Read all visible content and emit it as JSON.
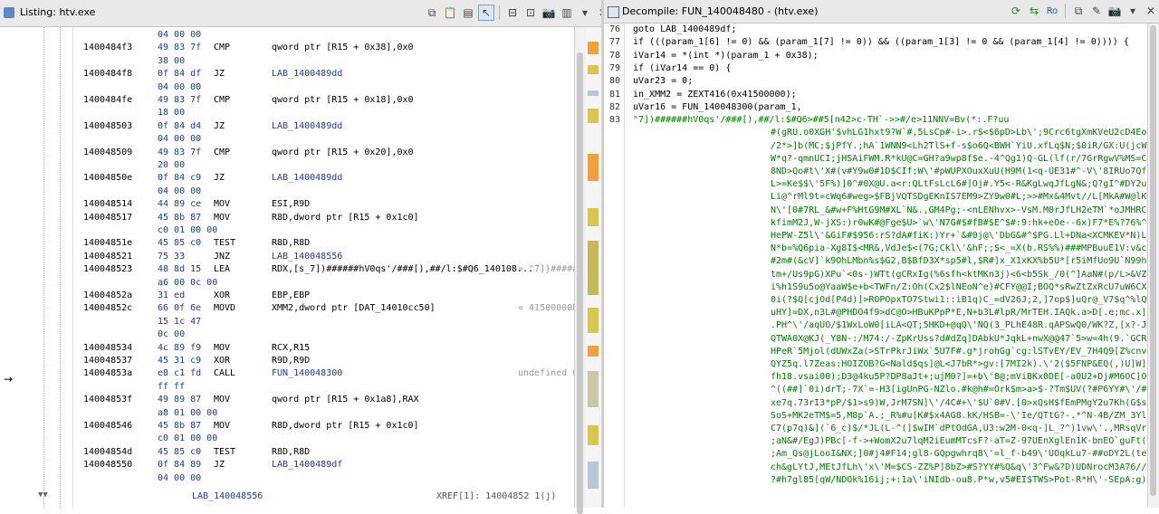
{
  "listing": {
    "title": "Listing:  htv.exe",
    "rows": [
      {
        "addr": "",
        "bytes": "04 00 00",
        "mn": "",
        "op": ""
      },
      {
        "addr": "1400484f3",
        "bytes": "49 83 7f",
        "mn": "CMP",
        "op": "qword ptr [R15 + 0x38],0x0"
      },
      {
        "addr": "",
        "bytes": "38 00",
        "mn": "",
        "op": ""
      },
      {
        "addr": "1400484f8",
        "bytes": "0f 84 df",
        "mn": "JZ",
        "op": "LAB_1400489dd"
      },
      {
        "addr": "",
        "bytes": "04 00 00",
        "mn": "",
        "op": ""
      },
      {
        "addr": "1400484fe",
        "bytes": "49 83 7f",
        "mn": "CMP",
        "op": "qword ptr [R15 + 0x18],0x0"
      },
      {
        "addr": "",
        "bytes": "18 00",
        "mn": "",
        "op": ""
      },
      {
        "addr": "140048503",
        "bytes": "0f 84 d4",
        "mn": "JZ",
        "op": "LAB_1400489dd"
      },
      {
        "addr": "",
        "bytes": "04 00 00",
        "mn": "",
        "op": ""
      },
      {
        "addr": "140048509",
        "bytes": "49 83 7f",
        "mn": "CMP",
        "op": "qword ptr [R15 + 0x20],0x0"
      },
      {
        "addr": "",
        "bytes": "20 00",
        "mn": "",
        "op": ""
      },
      {
        "addr": "14004850e",
        "bytes": "0f 84 c9",
        "mn": "JZ",
        "op": "LAB_1400489dd"
      },
      {
        "addr": "",
        "bytes": "04 00 00",
        "mn": "",
        "op": ""
      },
      {
        "addr": "140048514",
        "bytes": "44 89 ce",
        "mn": "MOV",
        "op": "ESI,R9D"
      },
      {
        "addr": "140048517",
        "bytes": "45 8b 87",
        "mn": "MOV",
        "op": "R8D,dword ptr [R15 + 0x1c0]"
      },
      {
        "addr": "",
        "bytes": "c0 01 00 00",
        "mn": "",
        "op": ""
      },
      {
        "addr": "14004851e",
        "bytes": "45 85 c0",
        "mn": "TEST",
        "op": "R8D,R8D"
      },
      {
        "addr": "140048521",
        "bytes": "75 33",
        "mn": "JNZ",
        "op": "LAB_140048556"
      },
      {
        "addr": "140048523",
        "bytes": "48 8d 15",
        "mn": "LEA",
        "op": "RDX,[s_7])######hV0qs'/###[),##/l:$#Q6_140108...",
        "cm": "= \"7]}#####"
      },
      {
        "addr": "",
        "bytes": "a6 00 0c 00",
        "mn": "",
        "op": ""
      },
      {
        "addr": "14004852a",
        "bytes": "31 ed",
        "mn": "XOR",
        "op": "EBP,EBP"
      },
      {
        "addr": "14004852c",
        "bytes": "66 0f 6e",
        "mn": "MOVD",
        "op": "XMM2,dword ptr [DAT_14010cc50]",
        "cm": "= 41500000h"
      },
      {
        "addr": "",
        "bytes": "15 1c 47",
        "mn": "",
        "op": ""
      },
      {
        "addr": "",
        "bytes": "0c 00",
        "mn": "",
        "op": ""
      },
      {
        "addr": "140048534",
        "bytes": "4c 89 f9",
        "mn": "MOV",
        "op": "RCX,R15"
      },
      {
        "addr": "140048537",
        "bytes": "45 31 c9",
        "mn": "XOR",
        "op": "R9D,R9D"
      },
      {
        "addr": "14004853a",
        "bytes": "e8 c1 fd",
        "mn": "CALL",
        "op": "FUN_140048300",
        "cm": "undefined F"
      },
      {
        "addr": "",
        "bytes": "ff ff",
        "mn": "",
        "op": ""
      },
      {
        "addr": "14004853f",
        "bytes": "49 89 87",
        "mn": "MOV",
        "op": "qword ptr [R15 + 0x1a8],RAX"
      },
      {
        "addr": "",
        "bytes": "a8 01 00 00",
        "mn": "",
        "op": ""
      },
      {
        "addr": "140048546",
        "bytes": "45 8b 87",
        "mn": "MOV",
        "op": "R8D,dword ptr [R15 + 0x1c0]"
      },
      {
        "addr": "",
        "bytes": "c0 01 00 00",
        "mn": "",
        "op": ""
      },
      {
        "addr": "14004854d",
        "bytes": "45 85 c0",
        "mn": "TEST",
        "op": "R8D,R8D"
      },
      {
        "addr": "140048550",
        "bytes": "0f 84 89",
        "mn": "JZ",
        "op": "LAB_1400489df"
      },
      {
        "addr": "",
        "bytes": "04 00 00",
        "mn": "",
        "op": ""
      }
    ],
    "footer_label": "LAB_140048556",
    "footer_xref": "XREF[1]:      14004852 1(j)"
  },
  "decompile": {
    "title": "Decompile: FUN_140048480 - (htv.exe)",
    "lines": [
      {
        "n": "76",
        "t": "  goto LAB_1400489df;"
      },
      {
        "n": "77",
        "t": "  if (((param_1[6] != 0) && (param_1[7] != 0)) && ((param_1[3] != 0 && (param_1[4] != 0)))) {"
      },
      {
        "n": "78",
        "t": "    iVar14 = *(int *)(param_1 + 0x38);"
      },
      {
        "n": "79",
        "t": "    if (iVar14 == 0) {"
      },
      {
        "n": "80",
        "t": "      uVar23 = 0;"
      },
      {
        "n": "81",
        "t": "      in_XMM2 = ZEXT416(0x41500000);"
      },
      {
        "n": "82",
        "t": "      uVar16 = FUN_140048300(param_1,"
      },
      {
        "n": "83",
        "t": "                   \"7])######hV0qs'/###[),##/l:$#Q6>##5[n42>c-TH`->>#/e>11NNV=Bv(*:.F?uu"
      }
    ],
    "string_lines": [
      "#(gRU.o0XGH'$vhLG1hxt9?W`#,5LsCp#-i>.r$<$6pD>Lb\\';9Crc6tgXmKVeU2cD4Eo3R",
      "/2*>]b(MC;$jPfY.;hA`1WNN9<Lh2TlS+f-s$o6Q<BWH`YiU.xfLq$N;$0iR/GX:U(jcW2p/",
      "W*q?-qmnUCI;jHSAiFWM.R*kU@C=GH?a9wp8f$e.-4^Qg1)Q-GL(lf(r/7GrRgwV%MS=C#`",
      "8ND>Qo#t\\'X#(v#Y9w0#1D$CIf;W\\'#pWUPXOuxXuU(H9M(1<q-UE31#^-V\\'8IRUo7Qf./",
      "L>=Ke$$\\'5F%)]0^#0X@U.a<r:QLtFsLcL6#]Oj#.Y5<-R&KgLwqJfLgN&;Q?gI^#DY2u",
      "Li@^rMl9t=cWq6#weg>$FBjVQTSDgEKnIS7EM9>ZY9w0#L;>>#Mx&4Mvt//L[MkA#W@lK.",
      "N\\'[0#7RL_&#w+F%HtG9M#XL`N&.,GM4Pg;-<nLENhvx>-VsM.M0rJfLH2eTM`*oJMHRC`N",
      "kfimM2J,W-jXS:)r0wK#@Fge$U>`w\\'N7G#$#fB#$E^$#:9:hk+eOe--6x)F7*E%?76%^GM",
      "HePW-Z5l\\'&GiF#$956:rS?dA#fiK:)Yr+`&#0j@\\'DbG&#^$PG.Ll+DNa<XCMKEV*N)LN/",
      "N*b=%Q6pia-Xg8I$<MR&,VdJe$<(7G;Ckl\\'&hF;;$<_=X(b.RS%%)###MPBuuE1V:v&cX&",
      "#2m#(&cV]`k9OhLMbn%s$G2,B$BfD3X*sp5#l,$R#]x_X1xKX%b5U*[r5iMfUo9U`N99hG)",
      "tm+/Us9pG)XPu`<0s-)WTt(gCRxIg(%6sfh<ktMKn3j)<6<b5Sk_/0(^]AaN#(p/L>&VZ>1",
      "i%h1S9u5o@YaaW$e+b<TWFn/Z:Oh(Cx2$lNEoN^e)#CFY@@I;BOQ*sRwZtZxRcU7uW6CXow",
      "0i(?$Q[cjOd[P4d)]>ROPOpxTO7Stwi1::iB1q)C_=dV26J;2,]7op$]uQr@_V7$q^%lQwt",
      "uHY]=DX,n3L#@PHDO4f9>dC@O>HBuKPpP*E,N+b3L#lpR/MrTEH.IAQk.a>D[.e;mc.x]Ip",
      ".PH^\\'/aqUO/$1WxLoW0[iLA<QT;5HKD+@qQ\\'NQ(3_PLhE48R.qAPSwQ0/WK?Z,[x?-J;j",
      "QTWA0X@KJ(_Y8N-:/M74:/-ZpKrUss?d#dZq]DAbkU*JqkL+nwX@@47`5>w=4h(9.`GCRUx",
      "HPeR`5Mjol(dUWxZa(>STrPkrJiWx`5U7F#.g*jrohGg`cg:lSTvEY/EV_7H4Q9[Z%cnv;J",
      "QYZ5q.l7Zeas:HOIZOB?G<Nald$qs]@L<J7bR*>gv:[7MI2k).\\'2($5FNP&EQ(,)U]W]+",
      "fh18.vsai00);D3@4ku5P?DP8aJt+;ujM0?]=+b\\'8@;mViBKx0DE[-a0U2+Dj#M6OC]O",
      "^((##]`0i)drT;-7X`=-H3[igUnPG-NZlo.#k@h#=Ork$m>a>$-?Tm$UV(?#P6YY#\\'/###",
      "xe7q.73rI3*pP/$1>s9)W,JrM7SN]\\'/4C#+\\'$U`0#V.[0>xQsH$fEmPMgY2u7Kh(G$sIfL",
      "SoS+MK2eTM$=5,M8p`A.;_R%#u[K#$x4AG8.kK/HSB=-\\'Ie/QTtG?-.*^N-4B/ZM_3YlQ",
      "C7(p7q)&](`6_c)$/*JL(L-^(]$wIM`dPtOdGA,U3:w2M-0<q-]L_?^)1vw\\'.,MRsqVr.L",
      ";aN&#/EgJ)PBc[-f->+WomX2u7lqM2iEumMTcsF?-aT=Z-97UEnXglEn1K-bnEO`guFt(c%=",
      ";Am_Qs@jLooI&NX;]0#j4#F14;gl8-GQpgwhrq8\\'=l_f-b49\\'UOqkLu7-##oDY2L(te+M",
      "ch&gLYtJ,MEtJfLh\\'x\\'M=$CS-ZZ%P]8bZ>#S?YY#%Q&q\\'3^Fw&?D)UDNrocM3A76//oL",
      "?#h7gl85[qW/NDOk%16ij;+:1a\\'iNIdb-ou8.P*w,v5#EI$TWS>Pot-R*H\\'-SEpA:g)f+"
    ]
  },
  "colors": {
    "panel_bg": "#e9e9e9",
    "accent": "#0000c4",
    "string": "#007d00",
    "highlight": "#ffff66",
    "label": "#1a3aaa"
  }
}
